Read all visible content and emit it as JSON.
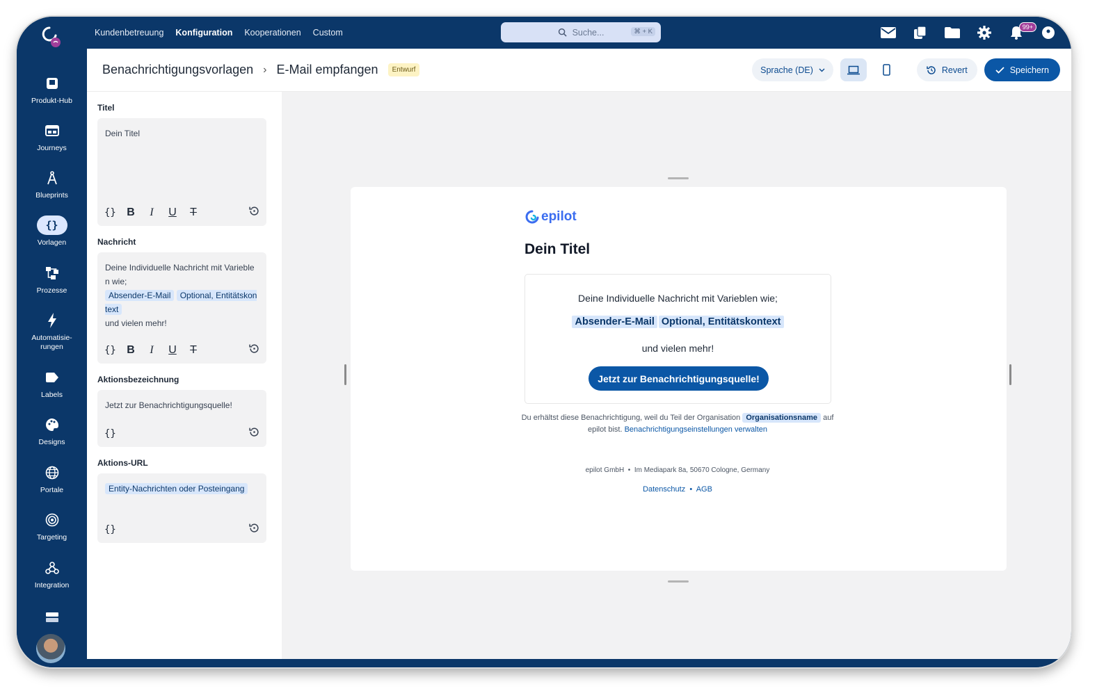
{
  "topnav": {
    "items": [
      {
        "label": "Kundenbetreuung",
        "active": false
      },
      {
        "label": "Konfiguration",
        "active": true
      },
      {
        "label": "Kooperationen",
        "active": false
      },
      {
        "label": "Custom",
        "active": false
      }
    ],
    "search_placeholder": "Suche...",
    "search_shortcut": "⌘ + K",
    "notification_badge": "99+"
  },
  "sidebar": {
    "items": [
      {
        "label": "Produkt-Hub",
        "icon": "product-hub-icon",
        "active": false
      },
      {
        "label": "Journeys",
        "icon": "journeys-icon",
        "active": false
      },
      {
        "label": "Blueprints",
        "icon": "blueprints-icon",
        "active": false
      },
      {
        "label": "Vorlagen",
        "icon": "templates-icon",
        "active": true
      },
      {
        "label": "Prozesse",
        "icon": "processes-icon",
        "active": false
      },
      {
        "label": "Automatisie-\nrungen",
        "icon": "automations-icon",
        "active": false
      },
      {
        "label": "Labels",
        "icon": "labels-icon",
        "active": false
      },
      {
        "label": "Designs",
        "icon": "designs-icon",
        "active": false
      },
      {
        "label": "Portale",
        "icon": "portals-icon",
        "active": false
      },
      {
        "label": "Targeting",
        "icon": "targeting-icon",
        "active": false
      },
      {
        "label": "Integration",
        "icon": "integration-icon",
        "active": false
      }
    ]
  },
  "header": {
    "breadcrumb_parent": "Benachrichtigungsvorlagen",
    "breadcrumb_current": "E-Mail empfangen",
    "status_badge": "Entwurf",
    "language_label": "Sprache (DE)",
    "revert_label": "Revert",
    "save_label": "Speichern"
  },
  "form": {
    "title": {
      "label": "Titel",
      "value": "Dein Titel"
    },
    "message": {
      "label": "Nachricht",
      "line1": "Deine Individuelle Nachricht mit Varieblen wie;",
      "chip1": "Absender-E-Mail",
      "chip2": "Optional, Entitätskontext",
      "line3": "und vielen mehr!"
    },
    "action_label": {
      "label": "Aktionsbezeichnung",
      "value": "Jetzt zur Benachrichtigungsquelle!"
    },
    "action_url": {
      "label": "Aktions-URL",
      "chip": "Entity-Nachrichten oder Posteingang"
    }
  },
  "preview": {
    "brand": "epilot",
    "title": "Dein Titel",
    "message_line1": "Deine Individuelle Nachricht mit Varieblen wie;",
    "chip1": "Absender-E-Mail",
    "chip2": "Optional, Entitätskontext",
    "message_line3": "und vielen mehr!",
    "cta": "Jetzt zur Benachrichtigungsquelle!",
    "footer_text_before": "Du erhältst diese Benachrichtigung, weil du Teil der Organisation",
    "footer_org_chip": "Organisationsname",
    "footer_text_after": "auf epilot bist.",
    "footer_link": "Benachrichtigungseinstellungen verwalten",
    "company_name": "epilot GmbH",
    "company_address": "Im Mediapark 8a, 50670 Cologne, Germany",
    "privacy_link": "Datenschutz",
    "terms_link": "AGB"
  },
  "colors": {
    "brand_navy": "#0b3769",
    "primary": "#0b57a6",
    "chip_bg": "#d7e6fb",
    "draft_bg": "#fdf3c4"
  }
}
